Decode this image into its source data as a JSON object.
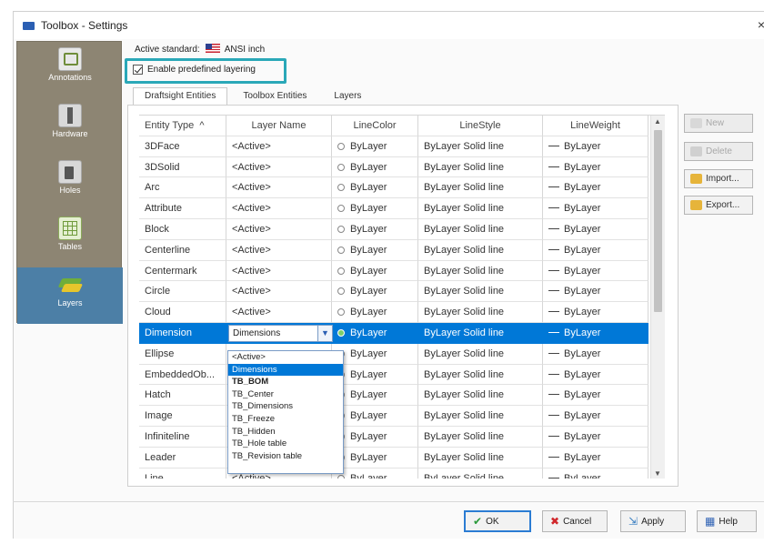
{
  "window": {
    "title": "Toolbox - Settings",
    "close_glyph": "×"
  },
  "nav": [
    {
      "label": "Annotations",
      "icon": "annotations-icon"
    },
    {
      "label": "Hardware",
      "icon": "hardware-icon"
    },
    {
      "label": "Holes",
      "icon": "holes-icon"
    },
    {
      "label": "Tables",
      "icon": "tables-icon"
    },
    {
      "label": "Layers",
      "icon": "layers-icon",
      "active": true
    }
  ],
  "standard": {
    "label": "Active standard:",
    "value": "ANSI inch"
  },
  "enable_layering": {
    "label": "Enable predefined layering",
    "checked": true
  },
  "tabs": [
    {
      "label": "Draftsight Entities",
      "active": true
    },
    {
      "label": "Toolbox Entities"
    },
    {
      "label": "Layers"
    }
  ],
  "grid": {
    "headers": [
      "Entity Type",
      "Layer Name",
      "LineColor",
      "LineStyle",
      "LineWeight"
    ],
    "sort_glyph": "^",
    "rows": [
      [
        "3DFace",
        "<Active>",
        "ByLayer",
        "ByLayer  Solid line",
        "ByLayer"
      ],
      [
        "3DSolid",
        "<Active>",
        "ByLayer",
        "ByLayer  Solid line",
        "ByLayer"
      ],
      [
        "Arc",
        "<Active>",
        "ByLayer",
        "ByLayer  Solid line",
        "ByLayer"
      ],
      [
        "Attribute",
        "<Active>",
        "ByLayer",
        "ByLayer  Solid line",
        "ByLayer"
      ],
      [
        "Block",
        "<Active>",
        "ByLayer",
        "ByLayer  Solid line",
        "ByLayer"
      ],
      [
        "Centerline",
        "<Active>",
        "ByLayer",
        "ByLayer  Solid line",
        "ByLayer"
      ],
      [
        "Centermark",
        "<Active>",
        "ByLayer",
        "ByLayer  Solid line",
        "ByLayer"
      ],
      [
        "Circle",
        "<Active>",
        "ByLayer",
        "ByLayer  Solid line",
        "ByLayer"
      ],
      [
        "Cloud",
        "<Active>",
        "ByLayer",
        "ByLayer  Solid line",
        "ByLayer"
      ],
      [
        "Dimension",
        "Dimensions",
        "ByLayer",
        "ByLayer  Solid line",
        "ByLayer"
      ],
      [
        "Ellipse",
        "",
        "ByLayer",
        "ByLayer  Solid line",
        "ByLayer"
      ],
      [
        "EmbeddedOb...",
        "",
        "ByLayer",
        "ByLayer  Solid line",
        "ByLayer"
      ],
      [
        "Hatch",
        "",
        "ByLayer",
        "ByLayer  Solid line",
        "ByLayer"
      ],
      [
        "Image",
        "",
        "ByLayer",
        "ByLayer  Solid line",
        "ByLayer"
      ],
      [
        "Infiniteline",
        "",
        "ByLayer",
        "ByLayer  Solid line",
        "ByLayer"
      ],
      [
        "Leader",
        "",
        "ByLayer",
        "ByLayer  Solid line",
        "ByLayer"
      ],
      [
        "Line",
        "<Active>",
        "ByLayer",
        "ByLayer  Solid line",
        "ByLayer"
      ]
    ],
    "selected_row": 9
  },
  "layer_dropdown": {
    "selected": "Dimensions",
    "options": [
      "<Active>",
      "Dimensions",
      "TB_BOM",
      "TB_Center",
      "TB_Dimensions",
      "TB_Freeze",
      "TB_Hidden",
      "TB_Hole table",
      "TB_Revision table"
    ],
    "highlighted_index": 1
  },
  "side_buttons": [
    {
      "label": "New",
      "disabled": true,
      "icon": "new-icon"
    },
    {
      "label": "Delete",
      "disabled": true,
      "icon": "delete-icon"
    },
    {
      "label": "Import...",
      "disabled": false,
      "icon": "import-icon"
    },
    {
      "label": "Export...",
      "disabled": false,
      "icon": "export-icon"
    }
  ],
  "footer": {
    "ok": "OK",
    "cancel": "Cancel",
    "apply": "Apply",
    "help": "Help"
  }
}
